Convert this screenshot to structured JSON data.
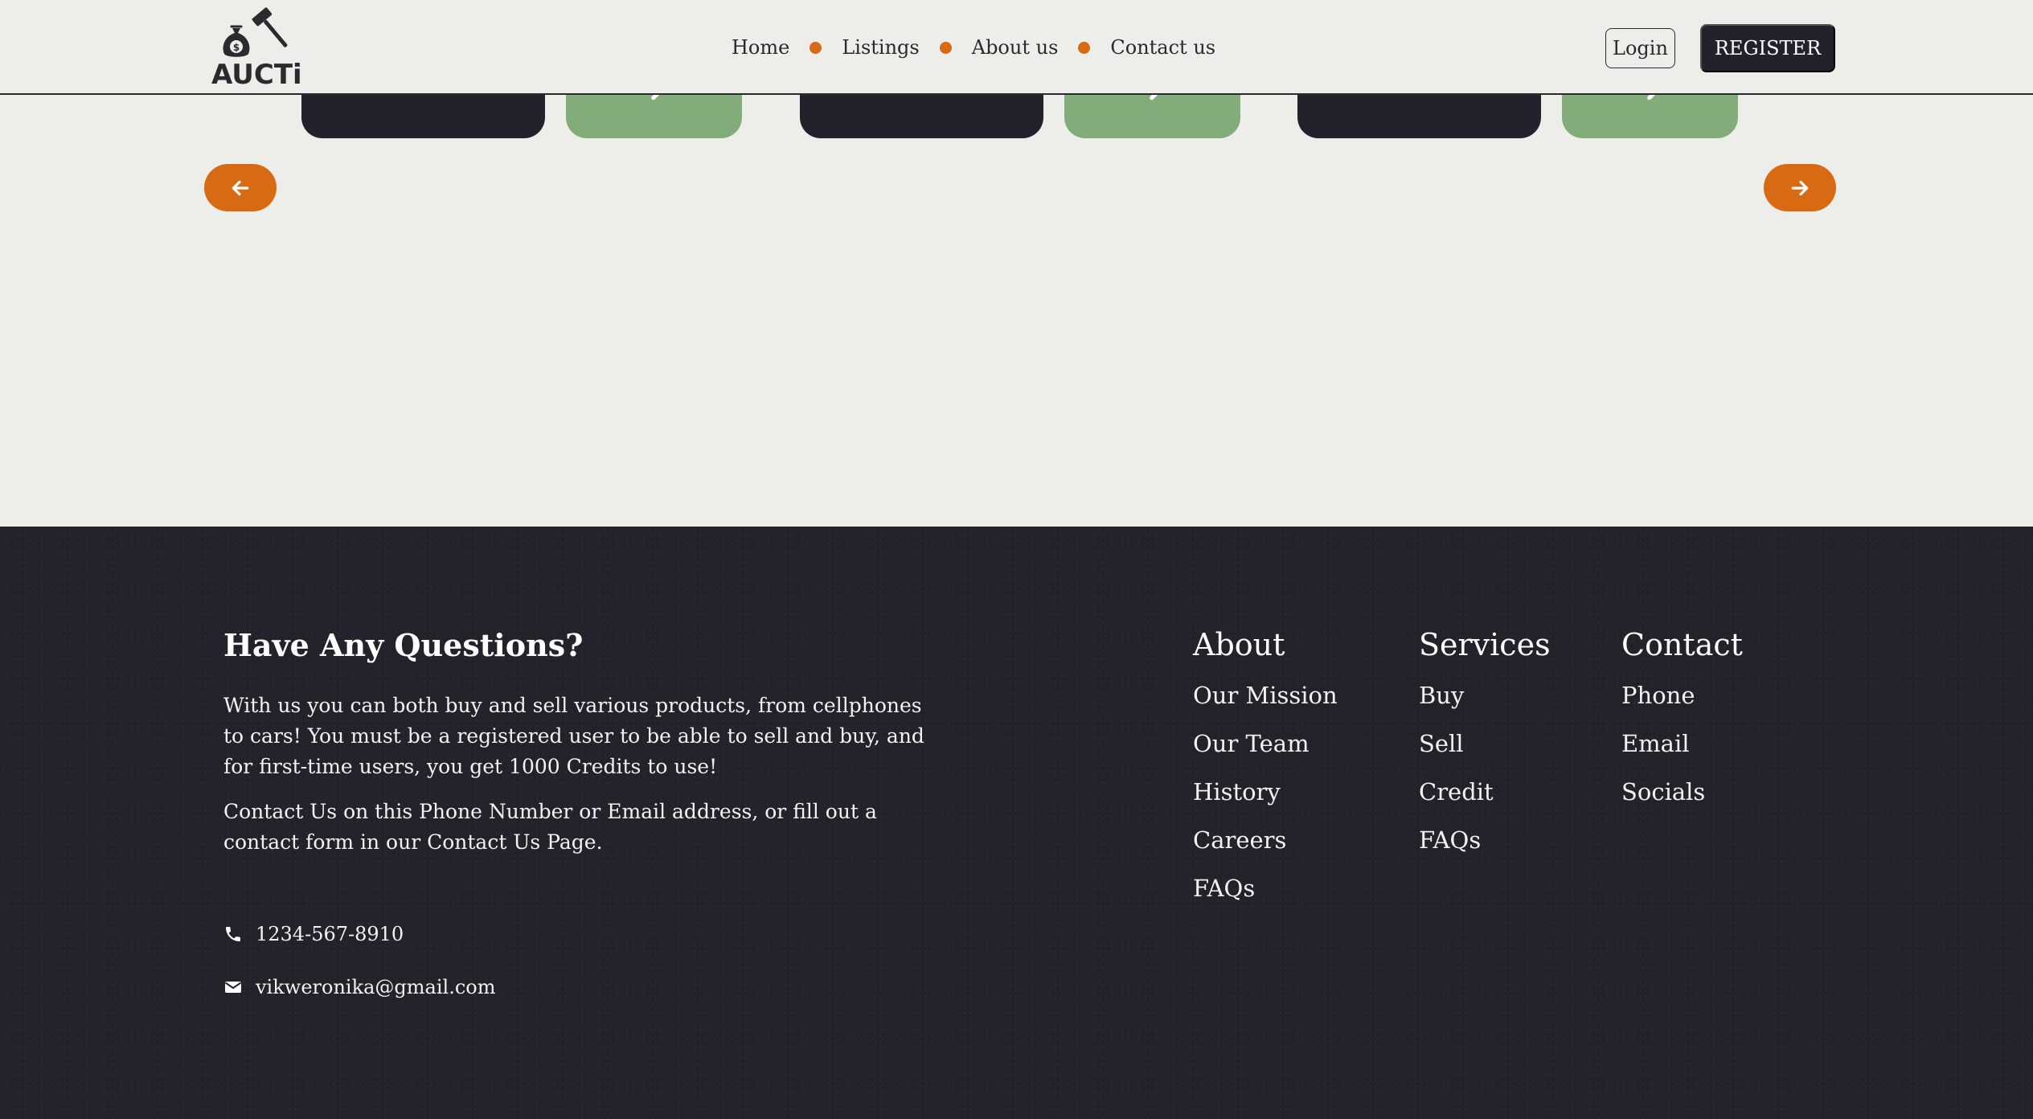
{
  "brand": {
    "name": "AUCTi",
    "logo_icon": "money-bag-gavel-icon",
    "bag_symbol": "$"
  },
  "nav": {
    "links": [
      {
        "label": "Home"
      },
      {
        "label": "Listings"
      },
      {
        "label": "About us"
      },
      {
        "label": "Contact us"
      }
    ],
    "login_label": "Login",
    "register_label": "REGISTER"
  },
  "carousel": {
    "prev_icon": "arrow-left-icon",
    "next_icon": "arrow-right-icon"
  },
  "footer": {
    "heading": "Have Any Questions?",
    "paragraph1": "With us you can both buy and sell various products, from cellphones to cars! You must be a registered user to be able to sell and buy, and for first-time users, you get 1000 Credits to use!",
    "paragraph2": "Contact Us on this Phone Number or Email address, or fill out a contact form in our Contact Us Page.",
    "phone": "1234-567-8910",
    "email": "vikweronika@gmail.com",
    "columns": {
      "about": {
        "title": "About",
        "links": [
          "Our Mission",
          "Our Team",
          "History",
          "Careers",
          "FAQs"
        ]
      },
      "services": {
        "title": "Services",
        "links": [
          "Buy",
          "Sell",
          "Credit",
          "FAQs"
        ]
      },
      "contact": {
        "title": "Contact",
        "links": [
          "Phone",
          "Email",
          "Socials"
        ]
      }
    }
  },
  "colors": {
    "accent": "#d96a14",
    "dark": "#23212b",
    "green": "#82ad7a",
    "background": "#edeee9"
  }
}
